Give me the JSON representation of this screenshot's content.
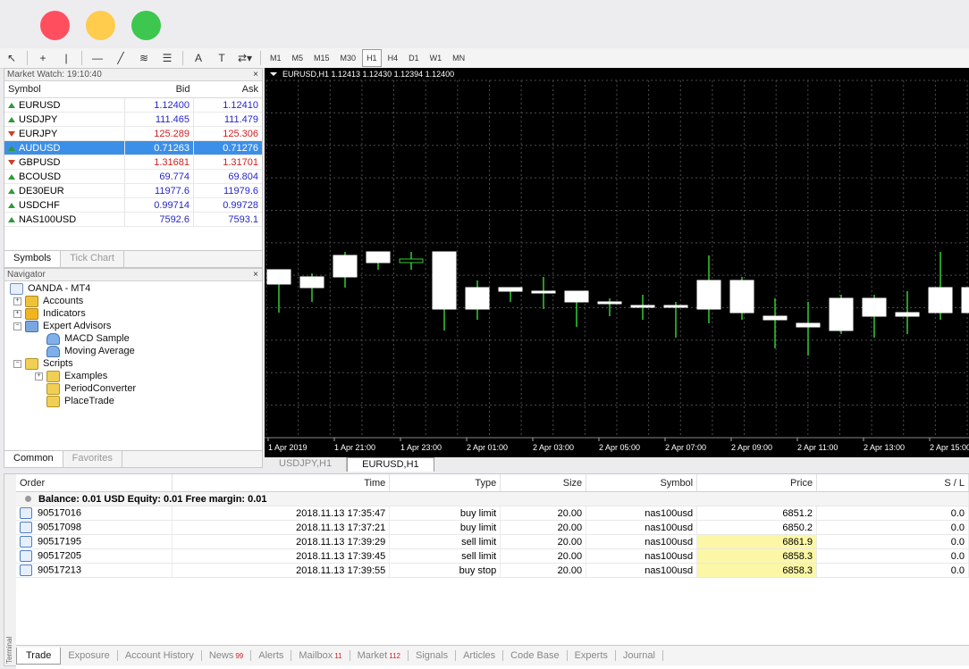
{
  "colors": {
    "up_marker": "#2e9a3a",
    "down_marker": "#d21e1e",
    "price_blue": "#2727c8",
    "selected_row": "#3c8fe6",
    "highlight_price": "#fbf7a6",
    "grid": "#4d4d4d",
    "candle_bull": "#ffffff",
    "wick": "#33cc33"
  },
  "toolbar": {
    "icons": [
      "cursor-icon",
      "crosshair-icon",
      "vertical-line-icon",
      "horizontal-line-icon",
      "trendline-icon",
      "fibonacci-icon",
      "channel-icon",
      "text-icon",
      "label-icon",
      "arrows-icon"
    ],
    "icon_glyphs": [
      "↖",
      "+",
      "|",
      "—",
      "╱",
      "≋",
      "☰",
      "A",
      "T",
      "⇄▾"
    ],
    "timeframes": [
      "M1",
      "M5",
      "M15",
      "M30",
      "H1",
      "H4",
      "D1",
      "W1",
      "MN"
    ],
    "active_timeframe": "H1"
  },
  "market_watch": {
    "title": "Market Watch: 19:10:40",
    "close": "×",
    "headers": {
      "symbol": "Symbol",
      "bid": "Bid",
      "ask": "Ask"
    },
    "rows": [
      {
        "symbol": "EURUSD",
        "bid": "1.12400",
        "ask": "1.12410",
        "dir": "up",
        "color": "blue"
      },
      {
        "symbol": "USDJPY",
        "bid": "111.465",
        "ask": "111.479",
        "dir": "up",
        "color": "blue"
      },
      {
        "symbol": "EURJPY",
        "bid": "125.289",
        "ask": "125.306",
        "dir": "down",
        "color": "red"
      },
      {
        "symbol": "AUDUSD",
        "bid": "0.71263",
        "ask": "0.71276",
        "dir": "up",
        "color": "blue",
        "selected": true
      },
      {
        "symbol": "GBPUSD",
        "bid": "1.31681",
        "ask": "1.31701",
        "dir": "down",
        "color": "red"
      },
      {
        "symbol": "BCOUSD",
        "bid": "69.774",
        "ask": "69.804",
        "dir": "up",
        "color": "blue"
      },
      {
        "symbol": "DE30EUR",
        "bid": "11977.6",
        "ask": "11979.6",
        "dir": "up",
        "color": "blue"
      },
      {
        "symbol": "USDCHF",
        "bid": "0.99714",
        "ask": "0.99728",
        "dir": "up",
        "color": "blue"
      },
      {
        "symbol": "NAS100USD",
        "bid": "7592.6",
        "ask": "7593.1",
        "dir": "up",
        "color": "blue"
      }
    ],
    "tabs": [
      "Symbols",
      "Tick Chart"
    ]
  },
  "navigator": {
    "title": "Navigator",
    "close": "×",
    "items": [
      {
        "label": "OANDA - MT4",
        "level": 0,
        "icon": "mt4",
        "expander": ""
      },
      {
        "label": "Accounts",
        "level": 1,
        "icon": "acc",
        "expander": "+"
      },
      {
        "label": "Indicators",
        "level": 1,
        "icon": "ind",
        "expander": "+"
      },
      {
        "label": "Expert Advisors",
        "level": 1,
        "icon": "ea",
        "expander": "−"
      },
      {
        "label": "MACD Sample",
        "level": 2,
        "icon": "hat",
        "expander": ""
      },
      {
        "label": "Moving Average",
        "level": 2,
        "icon": "hat",
        "expander": ""
      },
      {
        "label": "Scripts",
        "level": 1,
        "icon": "scr",
        "expander": "−"
      },
      {
        "label": "Examples",
        "level": 2,
        "icon": "scr",
        "expander": "+"
      },
      {
        "label": "PeriodConverter",
        "level": 2,
        "icon": "scr",
        "expander": ""
      },
      {
        "label": "PlaceTrade",
        "level": 2,
        "icon": "scr",
        "expander": ""
      }
    ],
    "tabs": [
      "Common",
      "Favorites"
    ]
  },
  "chart": {
    "header": "EURUSD,H1  1.12413 1.12430 1.12394 1.12400",
    "tabs": [
      "USDJPY,H1",
      "EURUSD,H1"
    ],
    "active_tab": "EURUSD,H1"
  },
  "chart_data": {
    "type": "candlestick",
    "symbol": "EURUSD",
    "timeframe": "H1",
    "title": "EURUSD,H1  1.12413 1.12430 1.12394 1.12400",
    "x_tick_labels": [
      "1 Apr 2019",
      "1 Apr 21:00",
      "1 Apr 23:00",
      "2 Apr 01:00",
      "2 Apr 03:00",
      "2 Apr 05:00",
      "2 Apr 07:00",
      "2 Apr 09:00",
      "2 Apr 11:00",
      "2 Apr 13:00",
      "2 Apr 15:00"
    ],
    "ylim": [
      0,
      100
    ],
    "candles": [
      {
        "o": 43,
        "h": 47,
        "l": 35,
        "c": 47
      },
      {
        "o": 42,
        "h": 46,
        "l": 38,
        "c": 45
      },
      {
        "o": 45,
        "h": 52,
        "l": 42,
        "c": 51
      },
      {
        "o": 49,
        "h": 52,
        "l": 47,
        "c": 52
      },
      {
        "o": 50,
        "h": 52,
        "l": 47,
        "c": 49
      },
      {
        "o": 36,
        "h": 52,
        "l": 30,
        "c": 52
      },
      {
        "o": 36,
        "h": 44,
        "l": 33,
        "c": 42
      },
      {
        "o": 41,
        "h": 42,
        "l": 38,
        "c": 42
      },
      {
        "o": 41,
        "h": 45,
        "l": 36,
        "c": 41
      },
      {
        "o": 38,
        "h": 41,
        "l": 31,
        "c": 41
      },
      {
        "o": 38,
        "h": 39,
        "l": 34,
        "c": 38
      },
      {
        "o": 37,
        "h": 40,
        "l": 33,
        "c": 37
      },
      {
        "o": 37,
        "h": 38,
        "l": 28,
        "c": 37
      },
      {
        "o": 36,
        "h": 51,
        "l": 32,
        "c": 44
      },
      {
        "o": 35,
        "h": 45,
        "l": 33,
        "c": 44
      },
      {
        "o": 33,
        "h": 39,
        "l": 25,
        "c": 34
      },
      {
        "o": 31,
        "h": 38,
        "l": 23,
        "c": 32
      },
      {
        "o": 30,
        "h": 40,
        "l": 29,
        "c": 39
      },
      {
        "o": 34,
        "h": 40,
        "l": 28,
        "c": 39
      },
      {
        "o": 34,
        "h": 41,
        "l": 29,
        "c": 35
      },
      {
        "o": 35,
        "h": 52,
        "l": 33,
        "c": 42
      },
      {
        "o": 35,
        "h": 44,
        "l": 28,
        "c": 42
      }
    ]
  },
  "terminal": {
    "headers": [
      "Order",
      "Time",
      "Type",
      "Size",
      "Symbol",
      "Price",
      "S / L"
    ],
    "balance_line": "Balance: 0.01 USD  Equity: 0.01  Free margin: 0.01",
    "rows": [
      {
        "order": "90517016",
        "time": "2018.11.13 17:35:47",
        "type": "buy limit",
        "size": "20.00",
        "symbol": "nas100usd",
        "price": "6851.2",
        "sl": "0.0",
        "highlight": false
      },
      {
        "order": "90517098",
        "time": "2018.11.13 17:37:21",
        "type": "buy limit",
        "size": "20.00",
        "symbol": "nas100usd",
        "price": "6850.2",
        "sl": "0.0",
        "highlight": false
      },
      {
        "order": "90517195",
        "time": "2018.11.13 17:39:29",
        "type": "sell limit",
        "size": "20.00",
        "symbol": "nas100usd",
        "price": "6861.9",
        "sl": "0.0",
        "highlight": true
      },
      {
        "order": "90517205",
        "time": "2018.11.13 17:39:45",
        "type": "sell limit",
        "size": "20.00",
        "symbol": "nas100usd",
        "price": "6858.3",
        "sl": "0.0",
        "highlight": true
      },
      {
        "order": "90517213",
        "time": "2018.11.13 17:39:55",
        "type": "buy stop",
        "size": "20.00",
        "symbol": "nas100usd",
        "price": "6858.3",
        "sl": "0.0",
        "highlight": true
      }
    ],
    "side_label": "Terminal",
    "tabs": [
      {
        "label": "Trade",
        "badge": "",
        "active": true
      },
      {
        "label": "Exposure",
        "badge": ""
      },
      {
        "label": "Account History",
        "badge": ""
      },
      {
        "label": "News",
        "badge": "99"
      },
      {
        "label": "Alerts",
        "badge": ""
      },
      {
        "label": "Mailbox",
        "badge": "11"
      },
      {
        "label": "Market",
        "badge": "112"
      },
      {
        "label": "Signals",
        "badge": ""
      },
      {
        "label": "Articles",
        "badge": ""
      },
      {
        "label": "Code Base",
        "badge": ""
      },
      {
        "label": "Experts",
        "badge": ""
      },
      {
        "label": "Journal",
        "badge": ""
      }
    ]
  }
}
